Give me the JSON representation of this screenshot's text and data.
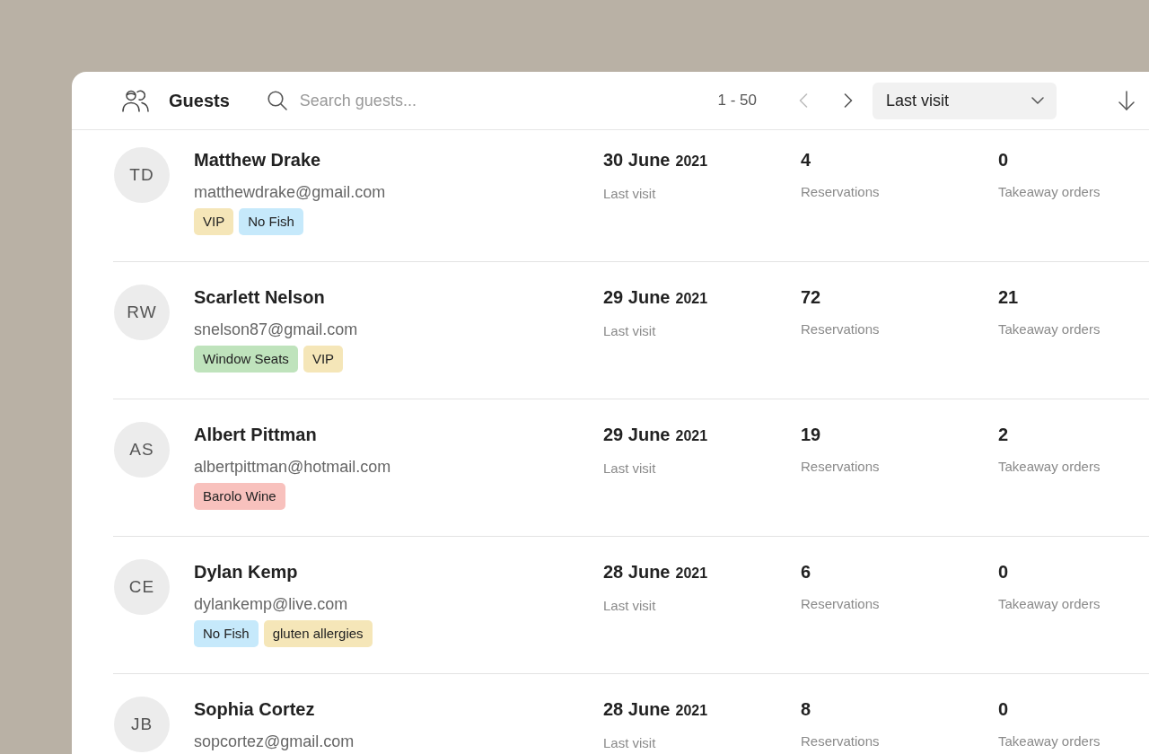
{
  "header": {
    "title": "Guests",
    "search": {
      "placeholder": "Search guests..."
    },
    "range": "1 - 50",
    "prev": {
      "disabled": true
    },
    "next": {
      "disabled": false
    },
    "sort": {
      "value": "Last visit"
    }
  },
  "guests": [
    {
      "initials": "TD",
      "name": "Matthew Drake",
      "email": "matthewdrake@gmail.com",
      "tags": [
        {
          "label": "VIP",
          "color": "#f5e6b8"
        },
        {
          "label": "No Fish",
          "color": "#c6e9fb"
        }
      ],
      "last_visit": {
        "date": "30 June",
        "year": "2021",
        "label": "Last visit"
      },
      "reservations": {
        "value": "4",
        "label": "Reservations"
      },
      "takeaway": {
        "value": "0",
        "label": "Takeaway orders"
      }
    },
    {
      "initials": "RW",
      "name": "Scarlett Nelson",
      "email": "snelson87@gmail.com",
      "tags": [
        {
          "label": "Window Seats",
          "color": "#bfe3bc"
        },
        {
          "label": "VIP",
          "color": "#f5e6b8"
        }
      ],
      "last_visit": {
        "date": "29 June",
        "year": "2021",
        "label": "Last visit"
      },
      "reservations": {
        "value": "72",
        "label": "Reservations"
      },
      "takeaway": {
        "value": "21",
        "label": "Takeaway orders"
      }
    },
    {
      "initials": "AS",
      "name": "Albert Pittman",
      "email": "albertpittman@hotmail.com",
      "tags": [
        {
          "label": "Barolo Wine",
          "color": "#f8c1bd"
        }
      ],
      "last_visit": {
        "date": "29 June",
        "year": "2021",
        "label": "Last visit"
      },
      "reservations": {
        "value": "19",
        "label": "Reservations"
      },
      "takeaway": {
        "value": "2",
        "label": "Takeaway orders"
      }
    },
    {
      "initials": "CE",
      "name": "Dylan Kemp",
      "email": "dylankemp@live.com",
      "tags": [
        {
          "label": "No Fish",
          "color": "#c6e9fb"
        },
        {
          "label": "gluten allergies",
          "color": "#f5e6b8"
        }
      ],
      "last_visit": {
        "date": "28 June",
        "year": "2021",
        "label": "Last visit"
      },
      "reservations": {
        "value": "6",
        "label": "Reservations"
      },
      "takeaway": {
        "value": "0",
        "label": "Takeaway orders"
      }
    },
    {
      "initials": "JB",
      "name": "Sophia Cortez",
      "email": "sopcortez@gmail.com",
      "last_visit": {
        "date": "28 June",
        "year": "2021",
        "label": "Last visit"
      },
      "reservations": {
        "value": "8",
        "label": "Reservations"
      },
      "takeaway": {
        "value": "0",
        "label": "Takeaway orders"
      }
    }
  ]
}
